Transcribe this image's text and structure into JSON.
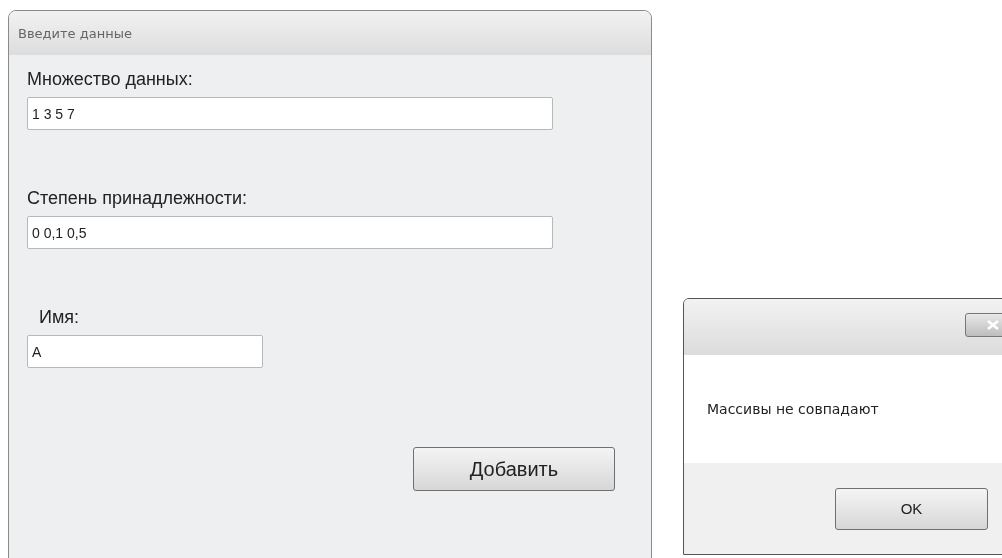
{
  "form_window": {
    "title": "Введите данные",
    "fields": [
      {
        "label": "Множество данных:",
        "value": "1 3 5 7",
        "kind": "wide"
      },
      {
        "label": "Степень принадлежности:",
        "value": "0 0,1 0,5",
        "kind": "wide"
      },
      {
        "label": "Имя:",
        "value": "A",
        "kind": "short"
      }
    ],
    "button": "Добавить"
  },
  "message_box": {
    "message": "Массивы не совпадают",
    "button": "OK"
  }
}
